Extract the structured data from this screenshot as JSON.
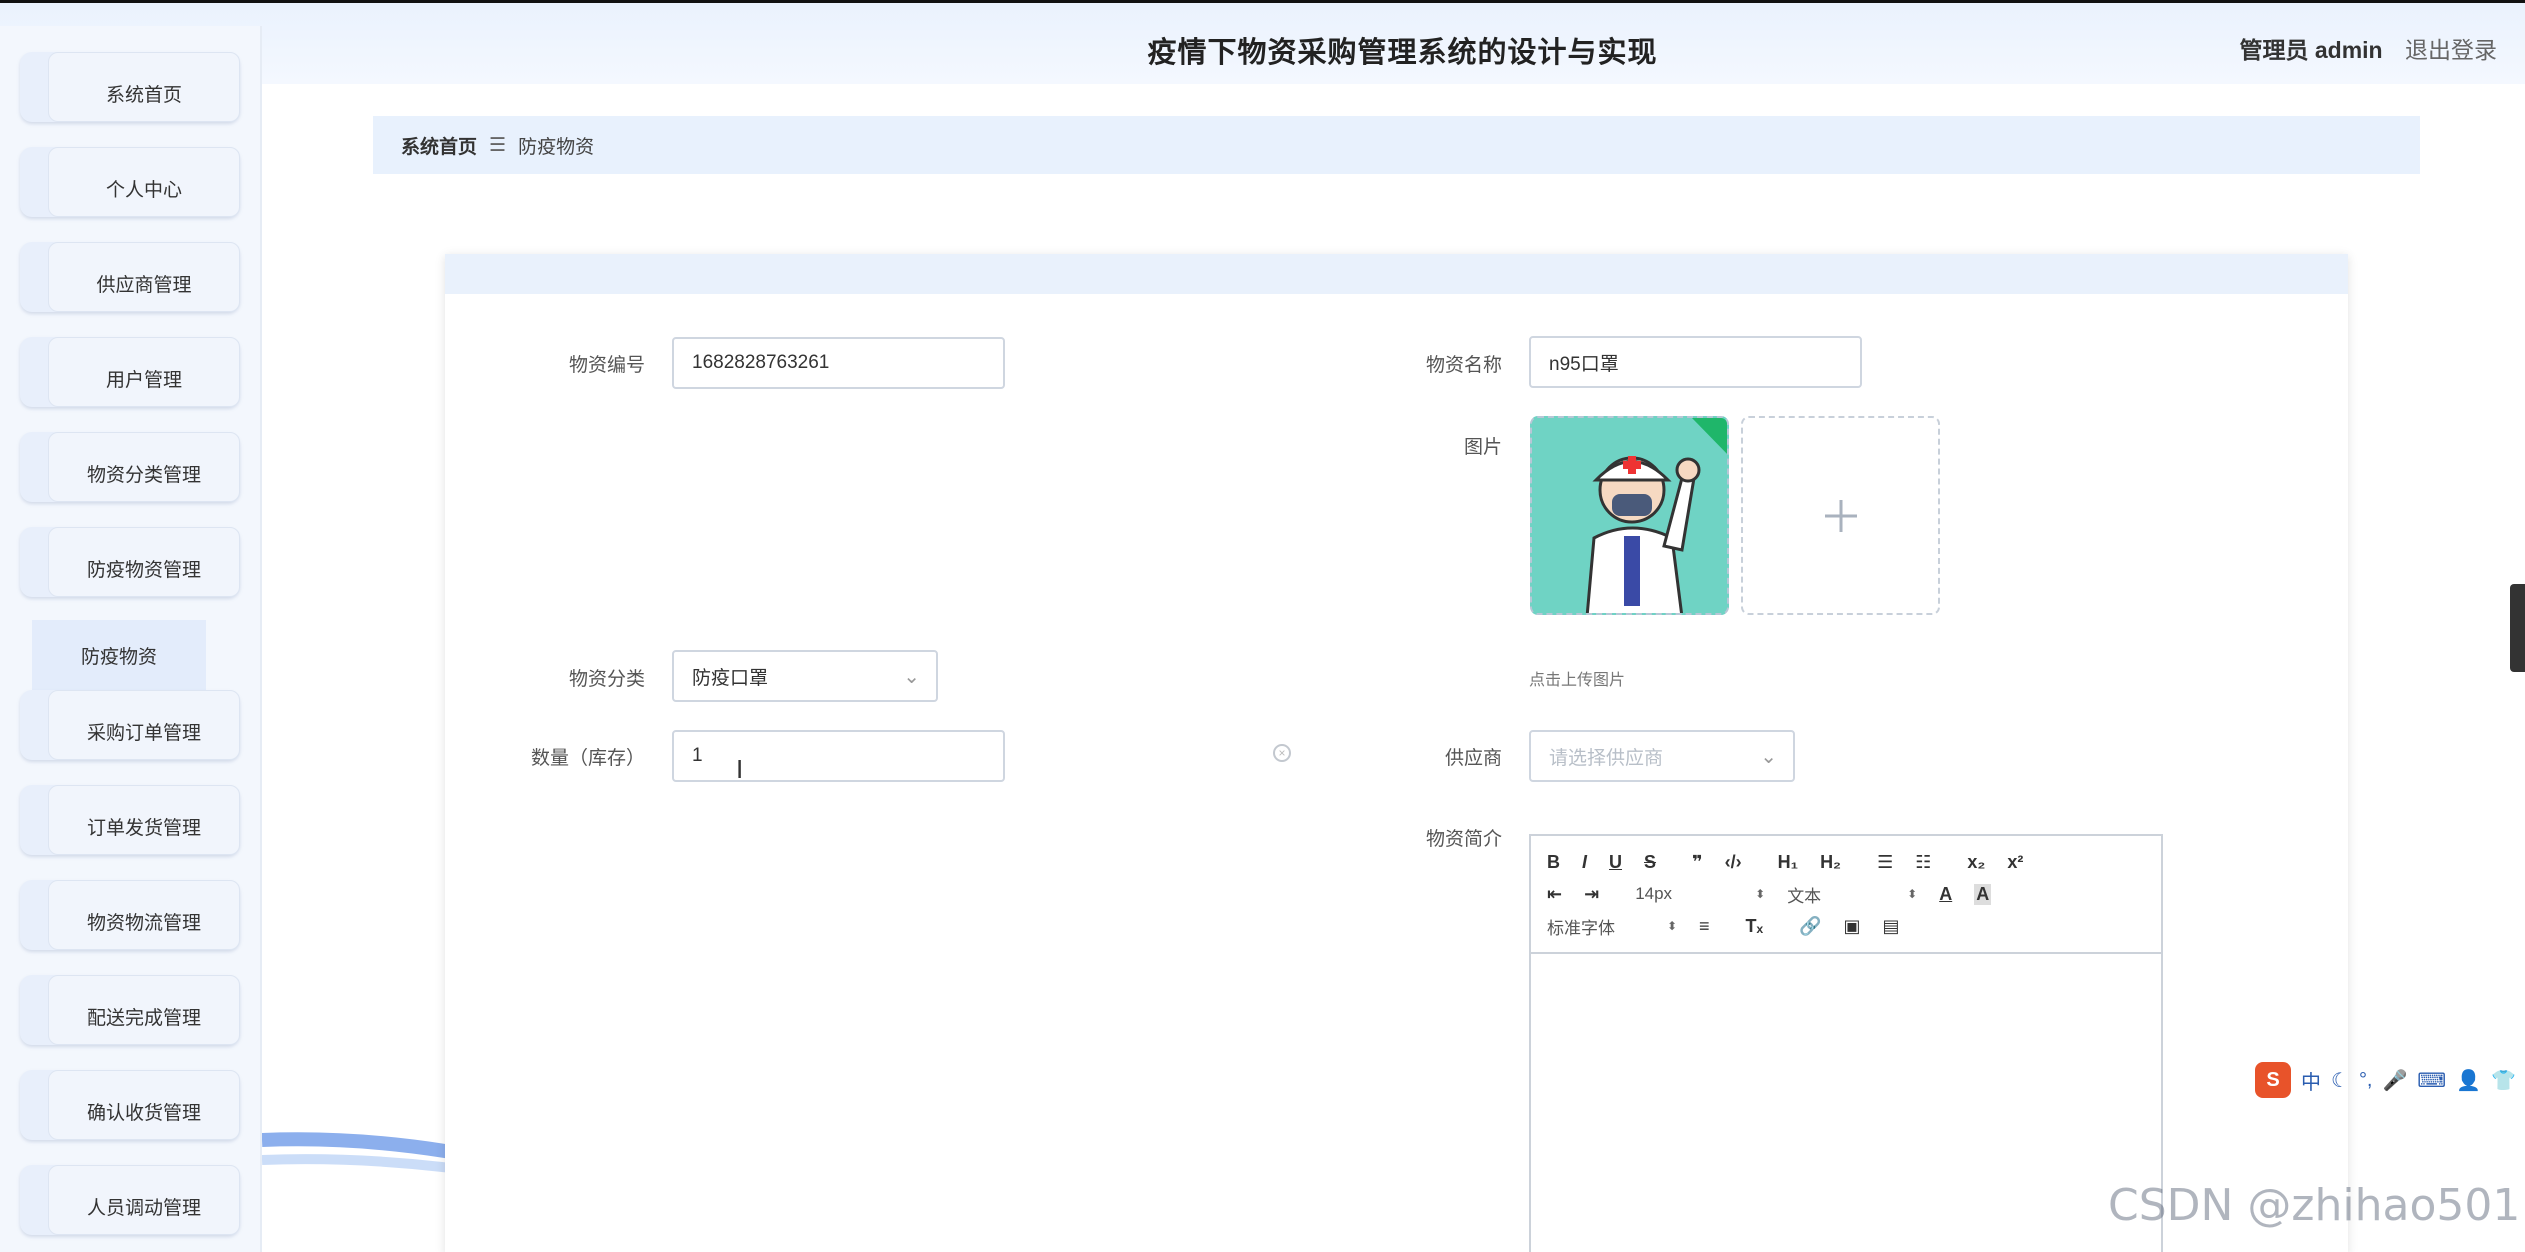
{
  "header": {
    "title": "疫情下物资采购管理系统的设计与实现",
    "user_label": "管理员 admin",
    "logout_label": "退出登录"
  },
  "sidebar": {
    "items": [
      {
        "label": "系统首页"
      },
      {
        "label": "个人中心"
      },
      {
        "label": "供应商管理"
      },
      {
        "label": "用户管理"
      },
      {
        "label": "物资分类管理"
      },
      {
        "label": "防疫物资管理"
      },
      {
        "label": "采购订单管理"
      },
      {
        "label": "订单发货管理"
      },
      {
        "label": "物资物流管理"
      },
      {
        "label": "配送完成管理"
      },
      {
        "label": "确认收货管理"
      },
      {
        "label": "人员调动管理"
      }
    ],
    "submenu_label": "防疫物资"
  },
  "breadcrumb": {
    "home": "系统首页",
    "separator": "☰",
    "current": "防疫物资"
  },
  "form": {
    "code_label": "物资编号",
    "code_value": "1682828763261",
    "name_label": "物资名称",
    "name_value": "n95口罩",
    "image_label": "图片",
    "upload_hint": "点击上传图片",
    "category_label": "物资分类",
    "category_value": "防疫口罩",
    "quantity_label": "数量（库存）",
    "quantity_value": "1",
    "supplier_label": "供应商",
    "supplier_placeholder": "请选择供应商",
    "intro_label": "物资简介"
  },
  "editor": {
    "font_size": "14px",
    "text_style": "文本",
    "font_family": "标准字体"
  },
  "ime": {
    "mode": "中"
  },
  "watermark": "CSDN @zhihao501"
}
